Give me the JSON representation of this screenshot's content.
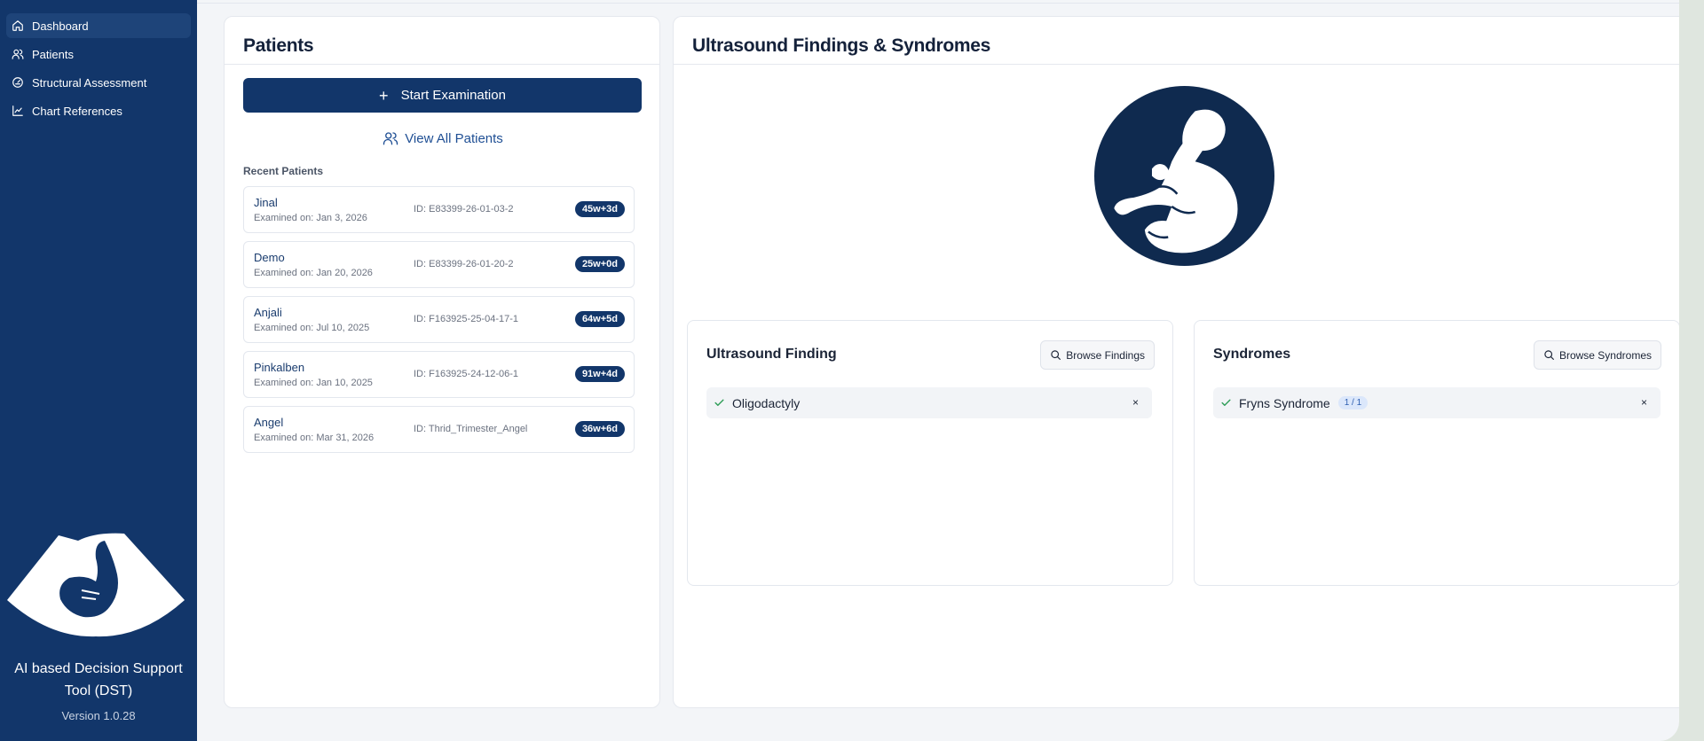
{
  "sidebar": {
    "items": [
      {
        "label": "Dashboard",
        "icon": "home-icon",
        "active": true
      },
      {
        "label": "Patients",
        "icon": "users-icon"
      },
      {
        "label": "Structural Assessment",
        "icon": "gauge-icon"
      },
      {
        "label": "Chart References",
        "icon": "line-chart-icon"
      }
    ],
    "app_title": "AI based Decision Support Tool (DST)",
    "version": "Version 1.0.28"
  },
  "patients_panel": {
    "title": "Patients",
    "start_button": "Start Examination",
    "view_all": "View All Patients",
    "recent_label": "Recent Patients",
    "patients": [
      {
        "name": "Jinal",
        "examined": "Examined on: Jan 3, 2026",
        "id": "ID: E83399-26-01-03-2",
        "ga": "45w+3d"
      },
      {
        "name": "Demo",
        "examined": "Examined on: Jan 20, 2026",
        "id": "ID: E83399-26-01-20-2",
        "ga": "25w+0d"
      },
      {
        "name": "Anjali",
        "examined": "Examined on: Jul 10, 2025",
        "id": "ID: F163925-25-04-17-1",
        "ga": "64w+5d"
      },
      {
        "name": "Pinkalben",
        "examined": "Examined on: Jan 10, 2025",
        "id": "ID: F163925-24-12-06-1",
        "ga": "91w+4d"
      },
      {
        "name": "Angel",
        "examined": "Examined on: Mar 31, 2026",
        "id": "ID: Thrid_Trimester_Angel",
        "ga": "36w+6d"
      }
    ]
  },
  "findings_panel": {
    "title": "Ultrasound Findings & Syndromes",
    "finding_card": {
      "title": "Ultrasound Finding",
      "browse": "Browse Findings",
      "selected": "Oligodactyly",
      "remove": "×"
    },
    "syndrome_card": {
      "title": "Syndromes",
      "browse": "Browse Syndromes",
      "selected": "Fryns Syndrome",
      "count": "1 / 1",
      "remove": "×"
    }
  },
  "colors": {
    "brand_navy": "#12366a",
    "check_green": "#2e9d57",
    "link_blue": "#1f4f94"
  }
}
